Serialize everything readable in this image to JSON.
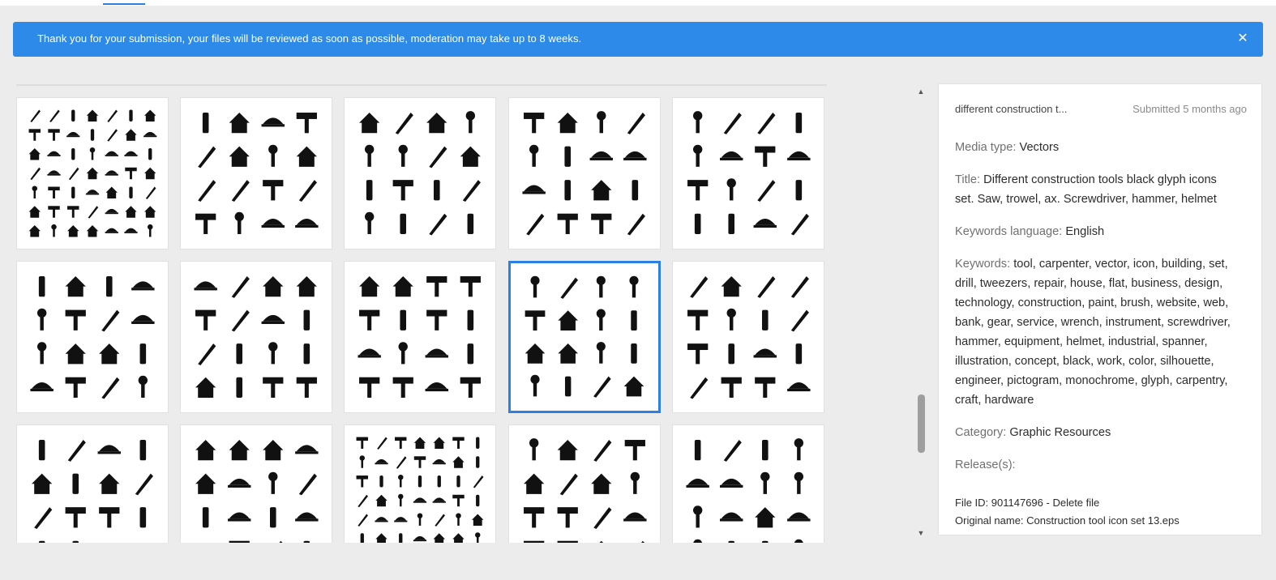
{
  "banner": {
    "message": "Thank you for your submission, your files will be reviewed as soon as possible, moderation may take up to 8 weeks.",
    "close_icon": "close-icon",
    "color": "#2d8ae8"
  },
  "grid": {
    "selected_index": 8,
    "tile_count": 15,
    "accent": "#2d80e2"
  },
  "details": {
    "name": "different construction t...",
    "submitted": "Submitted 5 months ago",
    "media_type_label": "Media type:",
    "media_type": "Vectors",
    "title_label": "Title:",
    "title": "Different construction tools black glyph icons set. Saw, trowel, ax. Screwdriver, hammer, helmet",
    "keywords_language_label": "Keywords language:",
    "keywords_language": "English",
    "keywords_label": "Keywords:",
    "keywords": "tool, carpenter, vector, icon, building, set, drill, tweezers, repair, house, flat, business, design, technology, construction, paint, brush, website, web, bank, gear, service, wrench, instrument, screwdriver, hammer, equipment, helmet, industrial, spanner, illustration, concept, black, work, color, silhouette, engineer, pictogram, monochrome, glyph, carpentry, craft, hardware",
    "category_label": "Category:",
    "category": "Graphic Resources",
    "releases_label": "Release(s):",
    "file_id_text": "File ID: 901147696 - ",
    "delete_label": "Delete file",
    "original_name_text": "Original name: Construction tool icon set 13.eps"
  }
}
